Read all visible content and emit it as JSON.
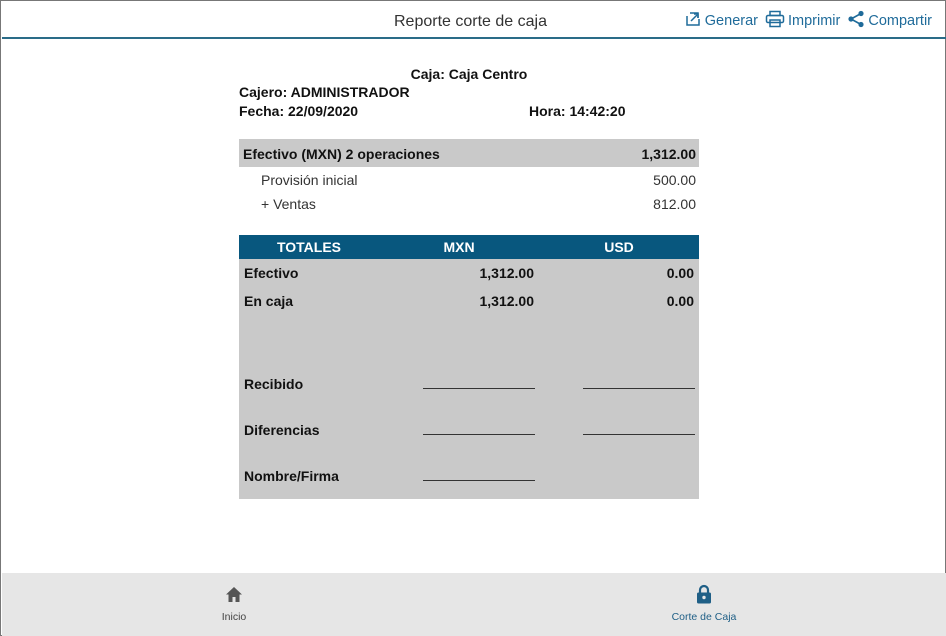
{
  "header": {
    "title": "Reporte corte de caja",
    "actions": [
      {
        "label": "Generar",
        "icon": "export-icon"
      },
      {
        "label": "Imprimir",
        "icon": "printer-icon"
      },
      {
        "label": "Compartir",
        "icon": "share-icon"
      }
    ]
  },
  "report": {
    "caja": "Caja: Caja Centro",
    "cajero": "Cajero: ADMINISTRADOR",
    "fecha": "Fecha: 22/09/2020",
    "hora": "Hora: 14:42:20",
    "cash_section": {
      "title": "Efectivo (MXN) 2 operaciones",
      "total": "1,312.00",
      "rows": [
        {
          "label": "Provisión inicial",
          "value": "500.00"
        },
        {
          "label": "+ Ventas",
          "value": "812.00"
        }
      ]
    },
    "totals": {
      "headers": [
        "TOTALES",
        "MXN",
        "USD"
      ],
      "rows": [
        {
          "label": "Efectivo",
          "mxn": "1,312.00",
          "usd": "0.00"
        },
        {
          "label": "En caja",
          "mxn": "1,312.00",
          "usd": "0.00"
        }
      ],
      "signature_rows": [
        {
          "label": "Recibido"
        },
        {
          "label": "Diferencias"
        },
        {
          "label": "Nombre/Firma"
        }
      ]
    }
  },
  "bottom_nav": {
    "items": [
      {
        "label": "Inicio",
        "icon": "home-icon"
      },
      {
        "label": "Corte de Caja",
        "icon": "lock-icon"
      }
    ]
  },
  "colors": {
    "accent": "#1f6b9a",
    "table_header": "#08577e",
    "row_gray": "#c9c9c9",
    "nav_bg": "#e6e6e6"
  }
}
